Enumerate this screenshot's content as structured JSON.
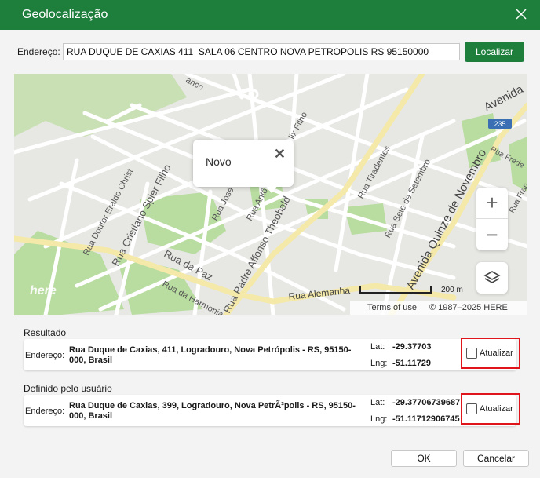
{
  "window": {
    "title": "Geolocalização"
  },
  "address": {
    "label": "Endereço:",
    "value": "RUA DUQUE DE CAXIAS 411  SALA 06 CENTRO NOVA PETROPOLIS RS 95150000",
    "locate_label": "Localizar"
  },
  "map": {
    "popup_text": "Novo",
    "popup_close": "✕",
    "zoom_in": "+",
    "zoom_out": "−",
    "scale_label": "200 m",
    "terms": "Terms of use",
    "copyright": "© 1987–2025 HERE",
    "brand": "here",
    "highway_shield": "235",
    "streets": [
      "Rua Doutor Eraldo Christ",
      "Rua Cristiano Spier Filho",
      "Rua da Paz",
      "Rua da Harmonia",
      "Rua José",
      "Rua Antô",
      "Rua Padre Affonso Theobald",
      "Rua Tiradentes",
      "Rua Sete de Setembro",
      "Avenida Quinze de Novembro",
      "Rua Alemanha",
      "Avenida",
      "Rua Frede",
      "Rua Fran",
      "lix Filho",
      "anco"
    ]
  },
  "result": {
    "section_label": "Resultado",
    "address_label": "Endereço:",
    "address": "Rua Duque de Caxias, 411, Logradouro, Nova Petrópolis - RS, 95150-000, Brasil",
    "lat_label": "Lat:",
    "lat": "-29.37703",
    "lng_label": "Lng:",
    "lng": "-51.11729",
    "update_label": "Atualizar"
  },
  "user_defined": {
    "section_label": "Definido pelo usuário",
    "address_label": "Endereço:",
    "address": "Rua Duque de Caxias, 399, Logradouro, Nova PetrÃ³polis - RS, 95150-000, Brasil",
    "lat_label": "Lat:",
    "lat": "-29.37706739687",
    "lng_label": "Lng:",
    "lng": "-51.11712906745",
    "update_label": "Atualizar"
  },
  "footer": {
    "ok_label": "OK",
    "cancel_label": "Cancelar"
  },
  "colors": {
    "titlebar": "#1e7e3c",
    "highlight": "#e0141b",
    "road_major": "#f4e9a8",
    "park": "#b9dca0"
  }
}
